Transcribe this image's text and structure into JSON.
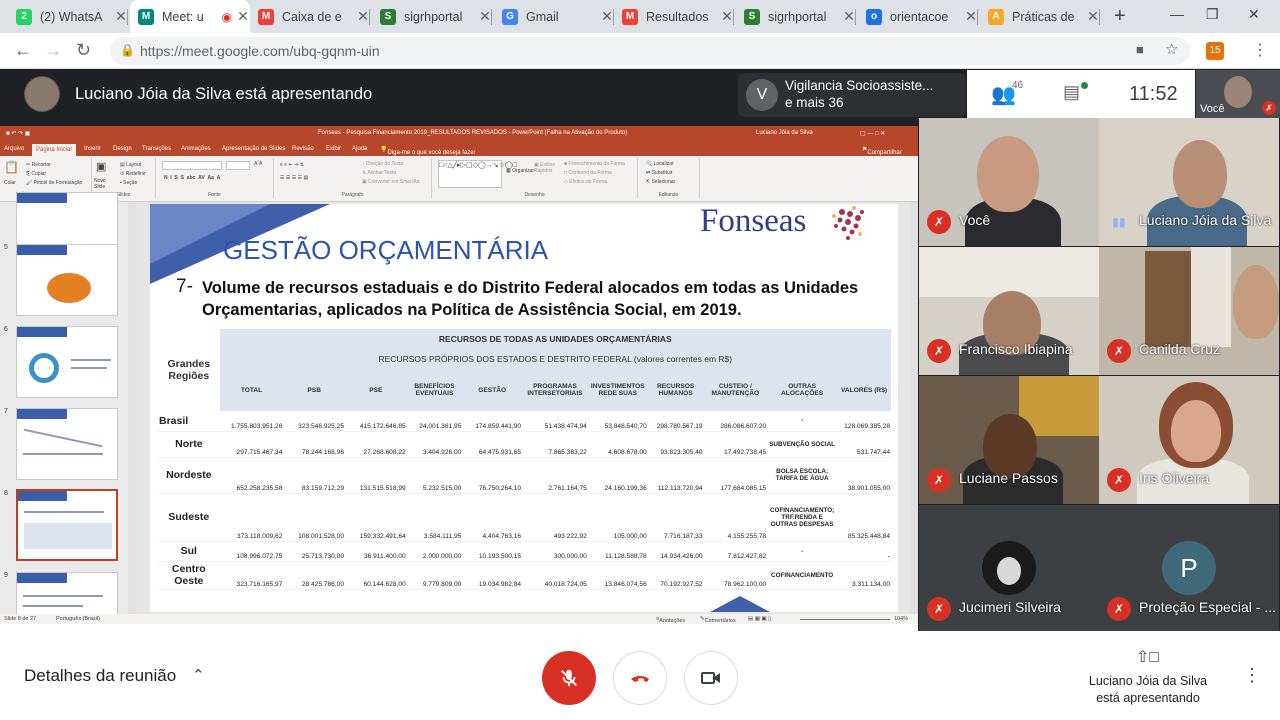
{
  "tabs": [
    {
      "label": "(2) WhatsA",
      "icon": "whatsapp-icon",
      "color": "#25d366",
      "glyph": "2"
    },
    {
      "label": "Meet: u",
      "icon": "meet-icon",
      "color": "#00897b",
      "glyph": "M",
      "active": true
    },
    {
      "label": "Caixa de e",
      "icon": "gmail-icon",
      "color": "#ea4335",
      "glyph": "M"
    },
    {
      "label": "sigrhportal",
      "icon": "sigrh-icon",
      "color": "#2e7d32",
      "glyph": "S"
    },
    {
      "label": "Gmail",
      "icon": "google-icon",
      "color": "#4285f4",
      "glyph": "G"
    },
    {
      "label": "Resultados",
      "icon": "gmail-icon",
      "color": "#ea4335",
      "glyph": "M"
    },
    {
      "label": "sigrhportal",
      "icon": "sigrh-icon",
      "color": "#2e7d32",
      "glyph": "S"
    },
    {
      "label": "orientacoe",
      "icon": "globe-icon",
      "color": "#1a73e8",
      "glyph": "o"
    },
    {
      "label": "Práticas de",
      "icon": "ava-icon",
      "color": "#f9a825",
      "glyph": "A"
    }
  ],
  "browser": {
    "url": "https://meet.google.com/ubq-gqnm-uin"
  },
  "meeting": {
    "presenter_title": "Luciano Jóia da Silva está apresentando",
    "group_initial": "V",
    "group_name": "Vigilancia Socioassiste...",
    "group_more": "e mais 36",
    "people_count": "46",
    "clock": "11:52",
    "self_label": "Você",
    "details_label": "Detalhes da reunião",
    "presenting_label_1": "Luciano Jóia da Silva",
    "presenting_label_2": "está apresentando"
  },
  "powerpoint": {
    "title_bar": "Fonseas - Pesquisa Financiamento 2019_RESULTADOS REVISADOS - PowerPoint (Falha na Ativação do Produto)",
    "user": "Luciano Jóia da Silva",
    "share": "Compartilhar",
    "ribbon_tabs": [
      "Arquivo",
      "Página Inicial",
      "Inserir",
      "Design",
      "Transições",
      "Animações",
      "Apresentação de Slides",
      "Revisão",
      "Exibir",
      "Ajuda",
      "Diga-me o que você deseja fazer"
    ],
    "ribbon_groups": [
      "Área de Transferência",
      "Slides",
      "Fonte",
      "Parágrafo",
      "Desenho",
      "Editando"
    ],
    "ribbon_items": {
      "colar": "Colar",
      "recortar": "Recortar",
      "copiar": "Copiar",
      "pincel": "Pincel de Formatação",
      "novo_slide": "Novo Slide",
      "layout": "Layout",
      "redefinir": "Redefinir",
      "secao": "Seção",
      "direcao": "Direção do Texto",
      "alinhar": "Alinhar Texto",
      "converter": "Converter em SmartArt",
      "organizar": "Organizar",
      "estilos": "Estilos Rápidos",
      "preenchimento": "Preenchimento da Forma",
      "contorno": "Contorno da Forma",
      "efeitos": "Efeitos de Forma",
      "localizar": "Localizar",
      "substituir": "Substituir",
      "selecionar": "Selecionar"
    },
    "thumb_numbers": [
      "4",
      "5",
      "6",
      "7",
      "8",
      "9"
    ],
    "status_slide": "Slide 8 de 27",
    "status_lang": "Português (Brasil)",
    "status_notes": "Anotações",
    "status_comments": "Comentários",
    "status_zoom": "104%"
  },
  "slide": {
    "logo": "Fonseas",
    "title": "GESTÃO ORÇAMENTÁRIA",
    "question_number": "7-",
    "question_text": "Volume de recursos estaduais e do Distrito Federal alocados em todas as Unidades Orçamentarias, aplicados na Política de Assistência Social, em 2019.",
    "table": {
      "header_all": "RECURSOS DE TODAS AS UNIDADES ORÇAMENTÁRIAS",
      "header_own": "RECURSOS PRÓPRIOS DOS ESTADOS E DESTRITO FEDERAL (valores correntes em R$)",
      "row_header": "Grandes Regiões",
      "columns": [
        "TOTAL",
        "PSB",
        "PSE",
        "BENEFÍCIOS EVENTUAIS",
        "GESTÃO",
        "PROGRAMAS INTERSETORIAIS",
        "INVESTIMENTOS REDE SUAS",
        "RECURSOS HUMANOS",
        "CUSTEIO / MANUTENÇÃO",
        "OUTRAS ALOCAÇÕES",
        "VALORES (R$)"
      ],
      "rows": [
        {
          "region": "Brasil",
          "values": [
            "1.755.803.951,26",
            "323.546.925,25",
            "415.172.646,85",
            "24.001.361,95",
            "174.859.441,90",
            "51.438.474,94",
            "53.848.540,70",
            "298.780.567,19",
            "286.086.607,20",
            "-",
            "128.069.385,28"
          ]
        },
        {
          "region": "Norte",
          "values": [
            "297.715.467,34",
            "78.244.168,96",
            "27.268.608,22",
            "3.404.926,00",
            "64.475.931,65",
            "7.865.363,22",
            "4.608.678,00",
            "93.823.305,40",
            "17.492.738,45",
            "SUBVENÇÃO SOCIAL",
            "531.747,44"
          ]
        },
        {
          "region": "Nordeste",
          "values": [
            "652.258.235,58",
            "83.159.712,29",
            "131.515.518,99",
            "5.232.515,00",
            "76.750.264,10",
            "2.761.164,75",
            "24.160.199,36",
            "112.113.720,94",
            "177.664.085,15",
            "BOLSA ESCOLA; TARIFA DE ÁGUA",
            "38.901.055,00"
          ]
        },
        {
          "region": "Sudeste",
          "values": [
            "373.118.009,62",
            "108.001.528,00",
            "159.332.491,64",
            "3.584.111,95",
            "4.404.763,16",
            "493.222,92",
            "105.000,00",
            "7.716.187,33",
            "4.155.255,78",
            "COFINANCIAMENTO; TRF.RENDA E OUTRAS DESPESAS",
            "85.325.448,84"
          ]
        },
        {
          "region": "Sul",
          "values": [
            "108.996.072,75",
            "25.713.730,00",
            "36.911.400,00",
            "2.000.000,00",
            "10.193.500,15",
            "300.000,00",
            "11.128.588,78",
            "14.934.426,00",
            "7.812.427,82",
            "-",
            "-"
          ]
        },
        {
          "region": "Centro Oeste",
          "values": [
            "323.716.165,97",
            "28.425.786,00",
            "60.144.628,00",
            "9.779.809,00",
            "19.034.982,84",
            "40.018.724,05",
            "13.846.074,56",
            "70.192.927,52",
            "78.962.100,00",
            "COFINANCIAMENTO",
            "3.311.134,00"
          ]
        }
      ]
    }
  },
  "participants": [
    {
      "name": "Você",
      "muted": true
    },
    {
      "name": "Luciano Jóia da Silva",
      "muted": false
    },
    {
      "name": "Francisco Ibiapina",
      "muted": true
    },
    {
      "name": "Canilda Cruz",
      "muted": true
    },
    {
      "name": "Luciane Passos",
      "muted": true
    },
    {
      "name": "Iris Oliveira",
      "muted": true
    },
    {
      "name": "Jucimeri Silveira",
      "muted": true
    },
    {
      "name": "Proteção Especial - ...",
      "muted": true,
      "initial": "P"
    }
  ],
  "colors": {
    "meet_bg": "#202124",
    "ppt_accent": "#b7472a",
    "muted_red": "#d93025",
    "slide_title": "#2b53b0"
  }
}
